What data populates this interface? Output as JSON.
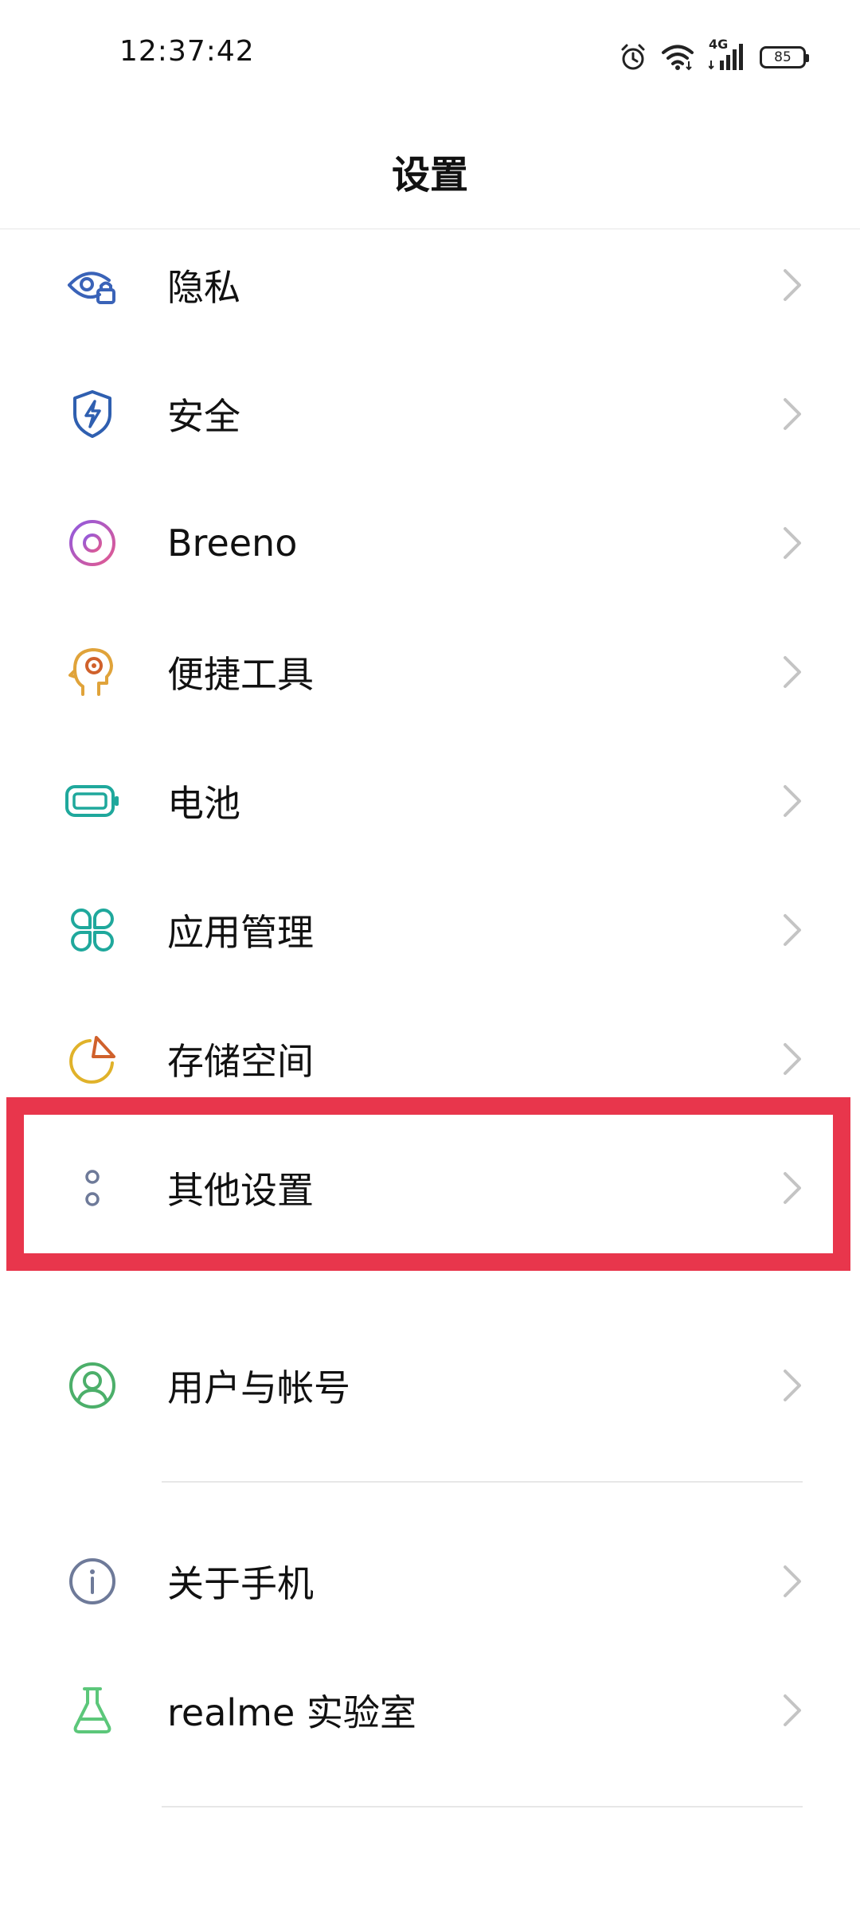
{
  "status_bar": {
    "time": "12:37:42",
    "network": "4G",
    "battery": "85",
    "icons": [
      "alarm-icon",
      "wifi-icon",
      "cellular-signal-icon",
      "battery-icon"
    ]
  },
  "header": {
    "title": "设置"
  },
  "settings": {
    "items": [
      {
        "label": "隐私",
        "icon": "privacy-eye-lock-icon",
        "color": "#3a63b8"
      },
      {
        "label": "安全",
        "icon": "security-shield-icon",
        "color": "#2f5fb0"
      },
      {
        "label": "Breeno",
        "icon": "breeno-ring-icon",
        "color": "#b65bd6"
      },
      {
        "label": "便捷工具",
        "icon": "convenience-head-icon",
        "color": "#e0a33a"
      },
      {
        "label": "电池",
        "icon": "battery-outline-icon",
        "color": "#1fa89c"
      },
      {
        "label": "应用管理",
        "icon": "app-management-icon",
        "color": "#1fa89c"
      },
      {
        "label": "存储空间",
        "icon": "storage-pie-icon",
        "color": "#e0b22a"
      },
      {
        "label": "其他设置",
        "icon": "other-settings-dots-icon",
        "color": "#6e7a99"
      },
      {
        "label": "用户与帐号",
        "icon": "user-account-icon",
        "color": "#4caf6a"
      },
      {
        "label": "关于手机",
        "icon": "about-phone-info-icon",
        "color": "#6e7a99"
      },
      {
        "label": "realme 实验室",
        "icon": "lab-flask-icon",
        "color": "#5cc77a"
      }
    ]
  },
  "colors": {
    "highlight": "#e8364c",
    "chevron": "#c4c4c4",
    "divider": "#e7e7e7"
  }
}
